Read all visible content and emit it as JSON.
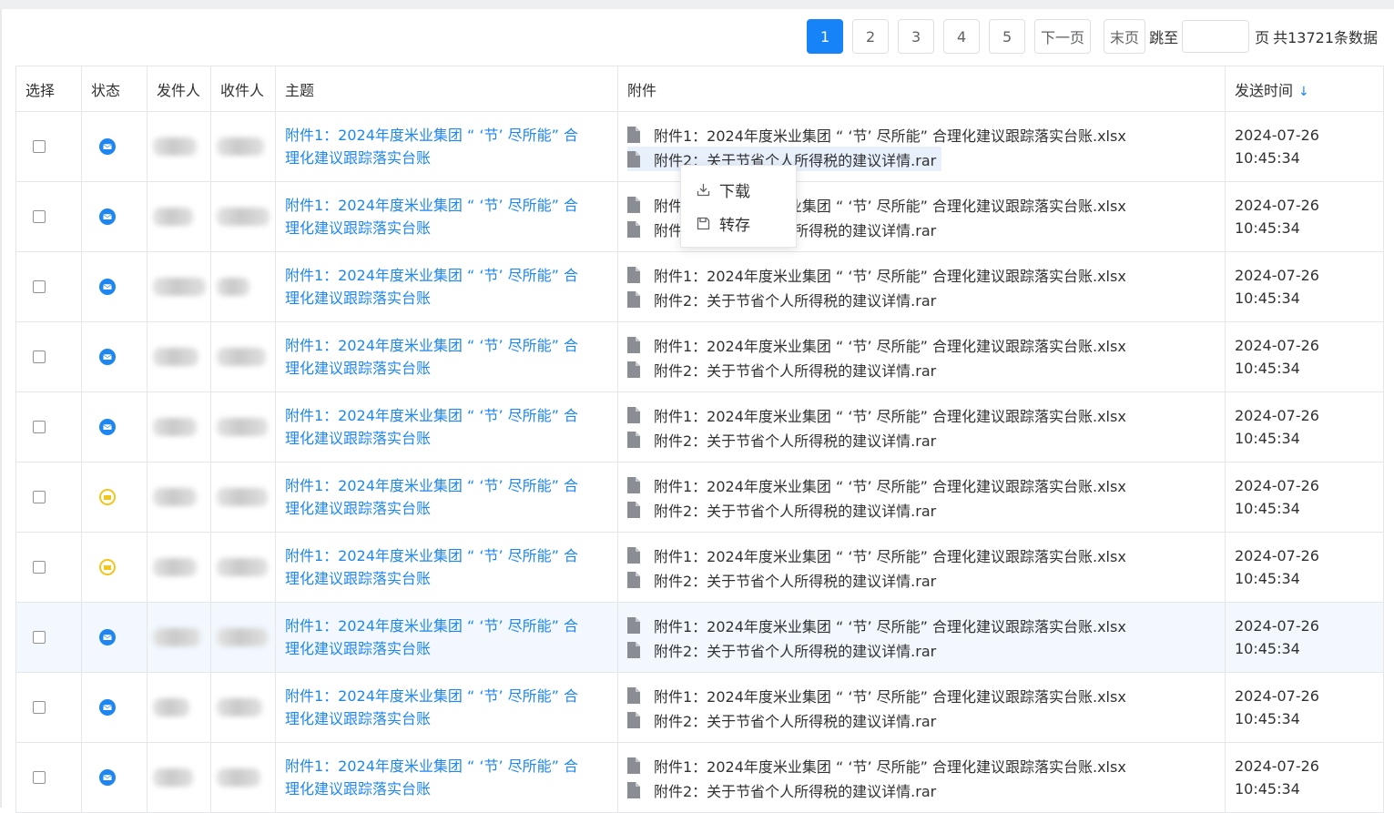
{
  "pagination": {
    "pages": [
      "1",
      "2",
      "3",
      "4",
      "5"
    ],
    "active_page": "1",
    "next_label": "下一页",
    "last_label": "末页",
    "jump_label": "跳至",
    "jump_value": "",
    "page_unit": "页",
    "total_label": "共13721条数据"
  },
  "columns": {
    "select": "选择",
    "status": "状态",
    "sender": "发件人",
    "recipient": "收件人",
    "subject": "主题",
    "attachments": "附件",
    "send_time": "发送时间"
  },
  "sort_icon": "arrow-down-icon",
  "status_colors": {
    "read": "#1e86f0",
    "unread": "#f2c51b"
  },
  "rows": [
    {
      "status": "read",
      "subject_1": "附件1：2024年度米业集团 “ ‘节’ 尽所能” 合",
      "subject_2": "理化建议跟踪落实台账",
      "att1": "附件1：2024年度米业集团 “ ‘节’ 尽所能” 合理化建议跟踪落实台账.xlsx",
      "att2": "附件2：关于节省个人所得税的建议详情.rar",
      "date": "2024-07-26",
      "time": "10:45:34"
    },
    {
      "status": "read",
      "subject_1": "附件1：2024年度米业集团 “ ‘节’ 尽所能” 合",
      "subject_2": "理化建议跟踪落实台账",
      "att1": "附件1：2024年度米业集团 “ ‘节’ 尽所能” 合理化建议跟踪落实台账.xlsx",
      "att2": "附件2：关于节省个人所得税的建议详情.rar",
      "date": "2024-07-26",
      "time": "10:45:34"
    },
    {
      "status": "read",
      "subject_1": "附件1：2024年度米业集团 “ ‘节’ 尽所能” 合",
      "subject_2": "理化建议跟踪落实台账",
      "att1": "附件1：2024年度米业集团 “ ‘节’ 尽所能” 合理化建议跟踪落实台账.xlsx",
      "att2": "附件2：关于节省个人所得税的建议详情.rar",
      "date": "2024-07-26",
      "time": "10:45:34"
    },
    {
      "status": "read",
      "subject_1": "附件1：2024年度米业集团 “ ‘节’ 尽所能” 合",
      "subject_2": "理化建议跟踪落实台账",
      "att1": "附件1：2024年度米业集团 “ ‘节’ 尽所能” 合理化建议跟踪落实台账.xlsx",
      "att2": "附件2：关于节省个人所得税的建议详情.rar",
      "date": "2024-07-26",
      "time": "10:45:34"
    },
    {
      "status": "read",
      "subject_1": "附件1：2024年度米业集团 “ ‘节’ 尽所能” 合",
      "subject_2": "理化建议跟踪落实台账",
      "att1": "附件1：2024年度米业集团 “ ‘节’ 尽所能” 合理化建议跟踪落实台账.xlsx",
      "att2": "附件2：关于节省个人所得税的建议详情.rar",
      "date": "2024-07-26",
      "time": "10:45:34"
    },
    {
      "status": "unread",
      "subject_1": "附件1：2024年度米业集团 “ ‘节’ 尽所能” 合",
      "subject_2": "理化建议跟踪落实台账",
      "att1": "附件1：2024年度米业集团 “ ‘节’ 尽所能” 合理化建议跟踪落实台账.xlsx",
      "att2": "附件2：关于节省个人所得税的建议详情.rar",
      "date": "2024-07-26",
      "time": "10:45:34"
    },
    {
      "status": "unread",
      "subject_1": "附件1：2024年度米业集团 “ ‘节’ 尽所能” 合",
      "subject_2": "理化建议跟踪落实台账",
      "att1": "附件1：2024年度米业集团 “ ‘节’ 尽所能” 合理化建议跟踪落实台账.xlsx",
      "att2": "附件2：关于节省个人所得税的建议详情.rar",
      "date": "2024-07-26",
      "time": "10:45:34"
    },
    {
      "status": "read",
      "subject_1": "附件1：2024年度米业集团 “ ‘节’ 尽所能” 合",
      "subject_2": "理化建议跟踪落实台账",
      "att1": "附件1：2024年度米业集团 “ ‘节’ 尽所能” 合理化建议跟踪落实台账.xlsx",
      "att2": "附件2：关于节省个人所得税的建议详情.rar",
      "date": "2024-07-26",
      "time": "10:45:34"
    },
    {
      "status": "read",
      "subject_1": "附件1：2024年度米业集团 “ ‘节’ 尽所能” 合",
      "subject_2": "理化建议跟踪落实台账",
      "att1": "附件1：2024年度米业集团 “ ‘节’ 尽所能” 合理化建议跟踪落实台账.xlsx",
      "att2": "附件2：关于节省个人所得税的建议详情.rar",
      "date": "2024-07-26",
      "time": "10:45:34"
    },
    {
      "status": "read",
      "subject_1": "附件1：2024年度米业集团 “ ‘节’ 尽所能” 合",
      "subject_2": "理化建议跟踪落实台账",
      "att1": "附件1：2024年度米业集团 “ ‘节’ 尽所能” 合理化建议跟踪落实台账.xlsx",
      "att2": "附件2：关于节省个人所得税的建议详情.rar",
      "date": "2024-07-26",
      "time": "10:45:34"
    }
  ],
  "context_menu": {
    "download_label": "下载",
    "download_icon": "download-icon",
    "save_label": "转存",
    "save_icon": "save-icon"
  }
}
